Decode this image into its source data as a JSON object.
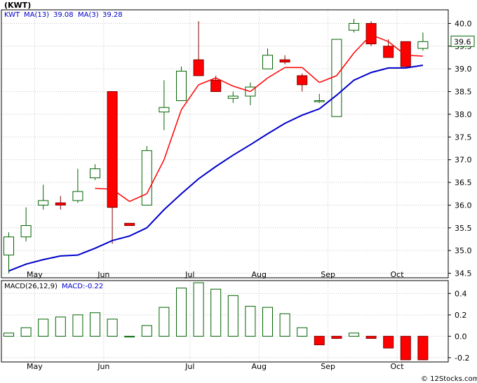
{
  "chart_data": {
    "type": "candlestick",
    "title": "(KWT)",
    "price_panel": {
      "legend": {
        "ticker": "KWT",
        "ma13_label": "MA(13)",
        "ma13_value": "39.08",
        "ma3_label": "MA(3)",
        "ma3_value": "39.28"
      },
      "current_price_label": "39.6",
      "ylim": [
        34.4,
        40.3
      ],
      "yticks": [
        "34.5",
        "35.0",
        "35.5",
        "36.0",
        "36.5",
        "37.0",
        "37.5",
        "38.0",
        "38.5",
        "39.0",
        "39.5",
        "40.0"
      ],
      "candles": [
        {
          "o": 34.9,
          "h": 35.4,
          "l": 34.5,
          "c": 35.3
        },
        {
          "o": 35.3,
          "h": 35.95,
          "l": 35.2,
          "c": 35.55
        },
        {
          "o": 36.0,
          "h": 36.45,
          "l": 35.9,
          "c": 36.1
        },
        {
          "o": 36.05,
          "h": 36.2,
          "l": 35.9,
          "c": 36.0
        },
        {
          "o": 36.1,
          "h": 36.8,
          "l": 36.05,
          "c": 36.3
        },
        {
          "o": 36.6,
          "h": 36.9,
          "l": 36.55,
          "c": 36.8
        },
        {
          "o": 38.5,
          "h": 38.5,
          "l": 35.15,
          "c": 35.95
        },
        {
          "o": 35.6,
          "h": 35.6,
          "l": 35.55,
          "c": 35.55
        },
        {
          "o": 36.0,
          "h": 37.3,
          "l": 36.0,
          "c": 37.2
        },
        {
          "o": 38.05,
          "h": 38.75,
          "l": 37.65,
          "c": 38.15
        },
        {
          "o": 38.3,
          "h": 39.05,
          "l": 38.3,
          "c": 38.95
        },
        {
          "o": 39.2,
          "h": 40.05,
          "l": 38.9,
          "c": 38.85
        },
        {
          "o": 38.75,
          "h": 38.85,
          "l": 38.5,
          "c": 38.5
        },
        {
          "o": 38.35,
          "h": 38.5,
          "l": 38.25,
          "c": 38.4
        },
        {
          "o": 38.4,
          "h": 38.7,
          "l": 38.2,
          "c": 38.6
        },
        {
          "o": 39.0,
          "h": 39.45,
          "l": 39.0,
          "c": 39.3
        },
        {
          "o": 39.2,
          "h": 39.3,
          "l": 39.1,
          "c": 39.15
        },
        {
          "o": 38.85,
          "h": 38.9,
          "l": 38.5,
          "c": 38.65
        },
        {
          "o": 38.3,
          "h": 38.45,
          "l": 38.25,
          "c": 38.3
        },
        {
          "o": 37.95,
          "h": 39.65,
          "l": 37.95,
          "c": 39.65
        },
        {
          "o": 39.85,
          "h": 40.1,
          "l": 39.8,
          "c": 40.0
        },
        {
          "o": 40.0,
          "h": 40.05,
          "l": 39.5,
          "c": 39.55
        },
        {
          "o": 39.5,
          "h": 39.65,
          "l": 39.25,
          "c": 39.25
        },
        {
          "o": 39.6,
          "h": 39.6,
          "l": 39.05,
          "c": 39.05
        },
        {
          "o": 39.45,
          "h": 39.8,
          "l": 39.4,
          "c": 39.6
        }
      ],
      "ma13": [
        34.55,
        34.7,
        34.8,
        34.88,
        34.9,
        35.05,
        35.22,
        35.32,
        35.5,
        35.9,
        36.25,
        36.58,
        36.85,
        37.1,
        37.33,
        37.57,
        37.8,
        37.98,
        38.12,
        38.42,
        38.75,
        38.92,
        39.02,
        39.02,
        39.08
      ],
      "ma3": [
        null,
        null,
        null,
        null,
        null,
        36.37,
        36.35,
        36.08,
        36.25,
        37.0,
        38.1,
        38.65,
        38.8,
        38.62,
        38.5,
        38.8,
        39.03,
        39.03,
        38.7,
        38.85,
        39.35,
        39.75,
        39.6,
        39.3,
        39.28
      ]
    },
    "macd_panel": {
      "legend": {
        "label": "MACD(26,12,9)",
        "value_label": "MACD:-0.22"
      },
      "ylim": [
        -0.24,
        0.52
      ],
      "yticks": [
        "0.4",
        "0.2",
        "0.0",
        "-0.2"
      ],
      "values": [
        0.03,
        0.08,
        0.16,
        0.18,
        0.2,
        0.22,
        0.16,
        0.0,
        0.1,
        0.27,
        0.45,
        0.5,
        0.44,
        0.38,
        0.28,
        0.27,
        0.21,
        0.08,
        -0.08,
        -0.02,
        0.03,
        -0.02,
        -0.11,
        -0.22,
        -0.22
      ]
    },
    "x_tick_labels": [
      {
        "label": "May",
        "index": 1
      },
      {
        "label": "Jun",
        "index": 5
      },
      {
        "label": "Jul",
        "index": 10
      },
      {
        "label": "Aug",
        "index": 14
      },
      {
        "label": "Sep",
        "index": 18
      },
      {
        "label": "Oct",
        "index": 22
      }
    ],
    "watermark": "© 12Stocks.com",
    "colors": {
      "up": "#006400",
      "down": "#ff0000",
      "ma13": "#0000cc",
      "ma3_above": "#0000cc",
      "ma3_below": "#ff0000",
      "grid": "#c8c8c8",
      "macd_pos": "#006400",
      "macd_neg": "#ff0000",
      "price_box": "#006400"
    }
  }
}
